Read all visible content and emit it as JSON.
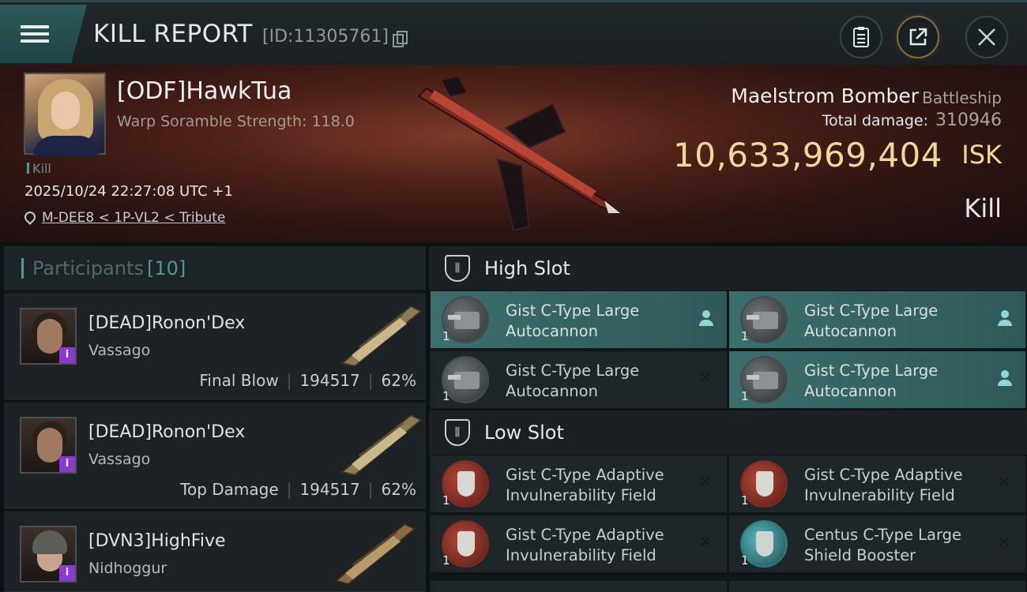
{
  "header": {
    "title": "KILL REPORT",
    "id_label": "[ID:11305761]"
  },
  "victim": {
    "name": "[ODF]HawkTua",
    "scramble": "Warp Soramble Strength: 118.0",
    "tag": "Kill",
    "datetime": "2025/10/24 22:27:08 UTC +1",
    "location": "M-DEE8 < 1P-VL2 < Tribute",
    "ship_name": "Maelstrom Bomber",
    "ship_class": "Battleship",
    "total_damage_label": "Total damage:",
    "total_damage_value": "310946",
    "isk_value": "10,633,969,404",
    "isk_unit": "ISK",
    "result": "Kill"
  },
  "participants": {
    "label": "Participants",
    "count": "[10]",
    "items": [
      {
        "name": "[DEAD]Ronon'Dex",
        "ship": "Vassago",
        "role": "Final Blow",
        "damage": "194517",
        "percent": "62%",
        "badge": "i"
      },
      {
        "name": "[DEAD]Ronon'Dex",
        "ship": "Vassago",
        "role": "Top Damage",
        "damage": "194517",
        "percent": "62%",
        "badge": "i"
      },
      {
        "name": "[DVN3]HighFive",
        "ship": "Nidhoggur",
        "badge": "i"
      }
    ]
  },
  "sections": {
    "high": "High Slot",
    "low": "Low Slot",
    "high_items": [
      {
        "name": "Gist C-Type Large Autocannon",
        "qty": "1",
        "status": "fitted"
      },
      {
        "name": "Gist C-Type Large Autocannon",
        "qty": "1",
        "status": "fitted"
      },
      {
        "name": "Gist C-Type Large Autocannon",
        "qty": "1",
        "status": "destroyed"
      },
      {
        "name": "Gist C-Type Large Autocannon",
        "qty": "1",
        "status": "fitted"
      }
    ],
    "low_items": [
      {
        "name": "Gist C-Type Adaptive Invulnerability Field",
        "qty": "1",
        "status": "destroyed"
      },
      {
        "name": "Gist C-Type Adaptive Invulnerability Field",
        "qty": "1",
        "status": "destroyed"
      },
      {
        "name": "Gist C-Type Adaptive Invulnerability Field",
        "qty": "1",
        "status": "destroyed"
      },
      {
        "name": "Centus C-Type Large Shield Booster",
        "qty": "1",
        "status": "destroyed"
      }
    ]
  },
  "icons": {
    "menu": "menu-icon",
    "copy": "copy-icon",
    "report": "clipboard-icon",
    "share": "share-icon",
    "close": "close-icon",
    "pin": "location-pin-icon",
    "fitted_marker": "person-icon",
    "destroyed_marker": "x-icon"
  },
  "colors": {
    "accent": "#4a9a98",
    "isk": "#f3d79a",
    "fitted_bg": "#3b6e6c",
    "badge": "#8a3ad0"
  }
}
